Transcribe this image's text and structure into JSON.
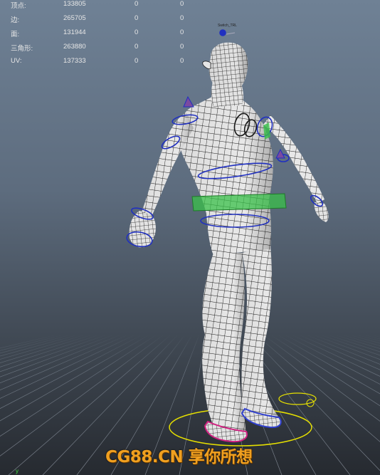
{
  "hud": {
    "rows": [
      {
        "label": "顶点:",
        "v1": "133805",
        "v2": "0",
        "v3": "0"
      },
      {
        "label": "边:",
        "v1": "265705",
        "v2": "0",
        "v3": "0"
      },
      {
        "label": "面:",
        "v1": "131944",
        "v2": "0",
        "v3": "0"
      },
      {
        "label": "三角形:",
        "v1": "263880",
        "v2": "0",
        "v3": "0"
      },
      {
        "label": "UV:",
        "v1": "137333",
        "v2": "0",
        "v3": "0"
      }
    ]
  },
  "viewport": {
    "axis_label": "y",
    "watermark": "CG88.CN 享你所想",
    "colors": {
      "background_top": "#6f8195",
      "grid": "#8893a0",
      "mesh_fill": "#e6e6e6",
      "wire": "#151515",
      "control_blue": "#2030c0",
      "control_green": "#39c04a",
      "control_yellow": "#e6e000",
      "watermark": "#f0a020"
    }
  }
}
